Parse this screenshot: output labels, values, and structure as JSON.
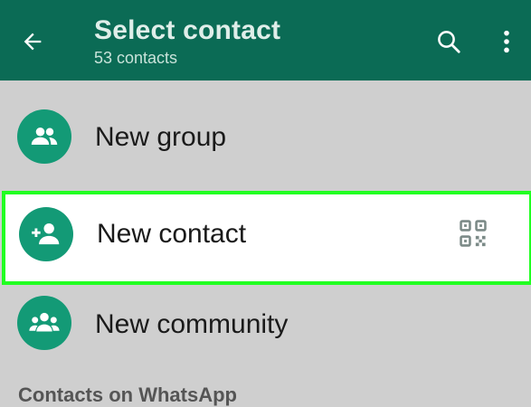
{
  "header": {
    "title": "Select contact",
    "subtitle": "53 contacts",
    "background_color": "#0b6b55",
    "back_icon": "arrow-left-icon",
    "search_icon": "search-icon",
    "more_icon": "more-vertical-icon"
  },
  "actions": [
    {
      "label": "New group",
      "icon": "group-icon"
    },
    {
      "label": "New contact",
      "icon": "add-person-icon",
      "trailing_icon": "qr-code-icon",
      "highlighted": true
    },
    {
      "label": "New community",
      "icon": "community-icon"
    }
  ],
  "section": {
    "label": "Contacts on WhatsApp"
  },
  "colors": {
    "accent": "#139a76",
    "highlight_border": "#21ff21",
    "list_background": "#cfcfcf"
  }
}
